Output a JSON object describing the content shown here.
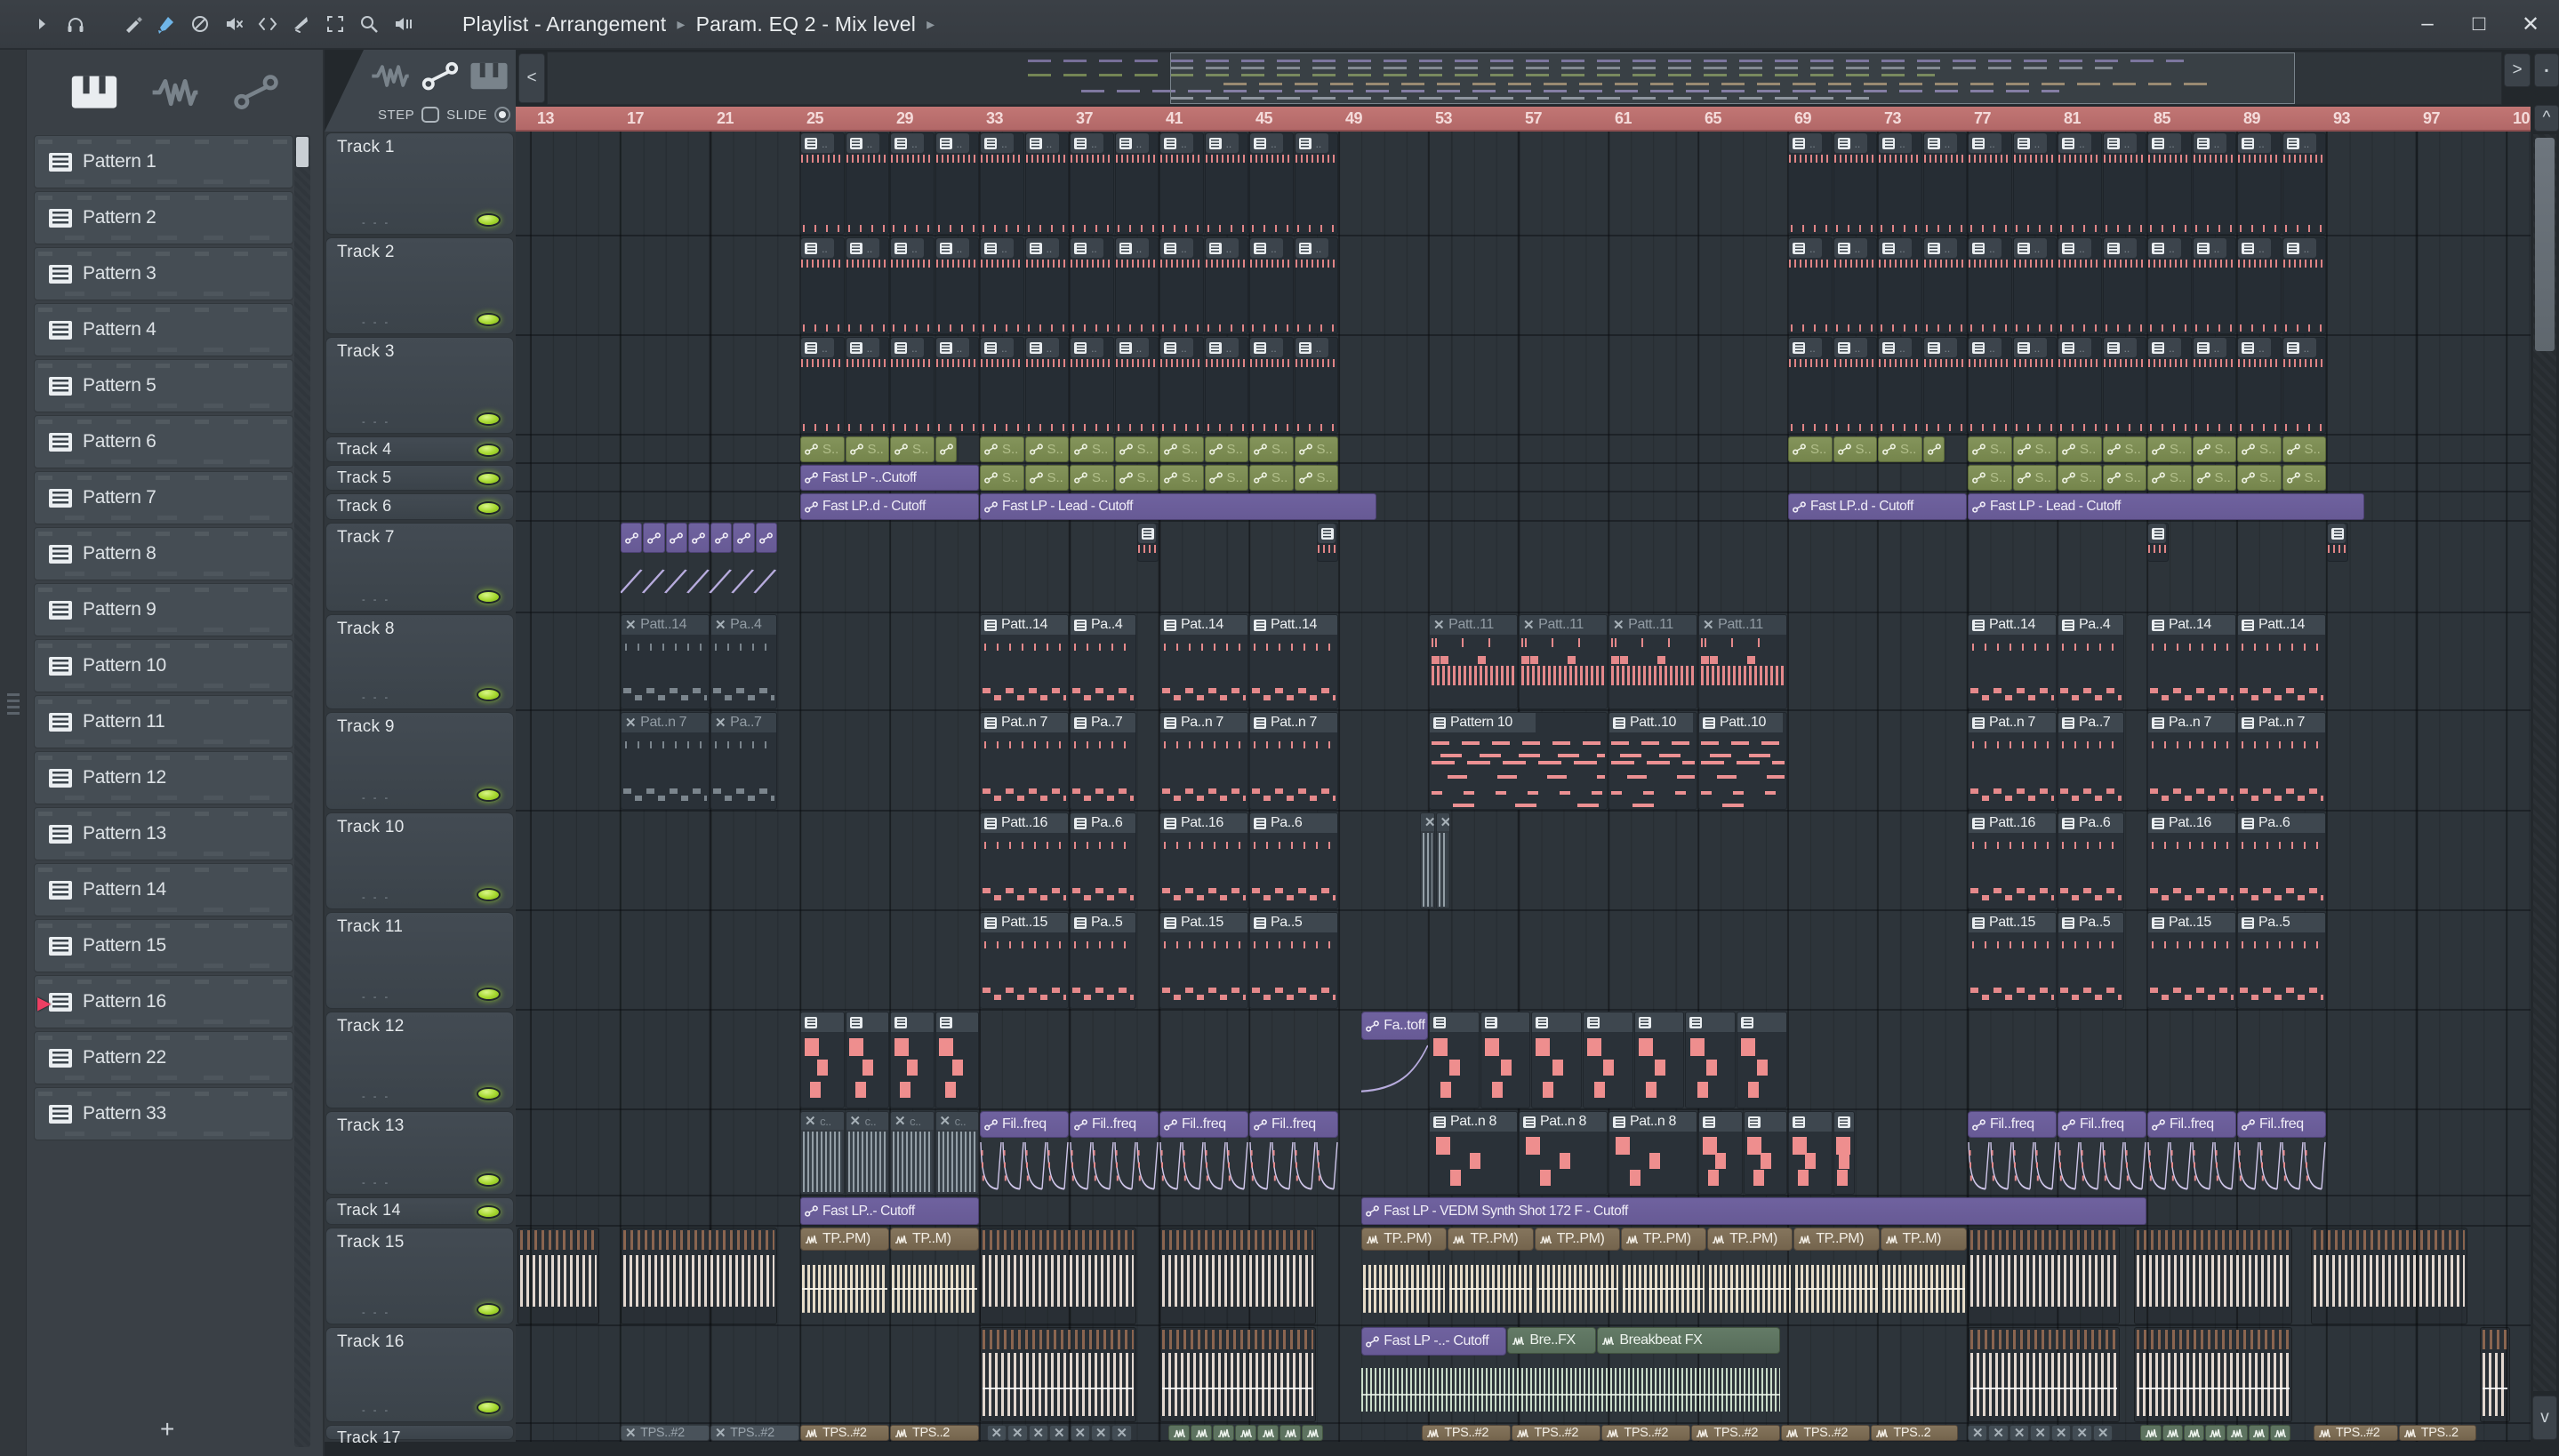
{
  "titlebar": {
    "crumb1": "Playlist - Arrangement",
    "crumb2": "Param. EQ 2 - Mix level",
    "window_buttons": [
      "–",
      "□",
      "✕"
    ],
    "tools": [
      "menu-arrow",
      "headphones",
      "draw",
      "paint",
      "delete",
      "mute",
      "slip",
      "slice",
      "select",
      "zoom",
      "playback"
    ],
    "active_tool": "paint"
  },
  "sidebar": {
    "tabs": [
      "piano",
      "wave",
      "slide"
    ],
    "active_tab": "piano",
    "patterns": [
      "Pattern 1",
      "Pattern 2",
      "Pattern 3",
      "Pattern 4",
      "Pattern 5",
      "Pattern 6",
      "Pattern 7",
      "Pattern 8",
      "Pattern 9",
      "Pattern 10",
      "Pattern 11",
      "Pattern 12",
      "Pattern 13",
      "Pattern 14",
      "Pattern 15",
      "Pattern 16",
      "Pattern 22",
      "Pattern 33"
    ],
    "playing_pattern": "Pattern 16",
    "add_label": "+"
  },
  "playlist": {
    "corner_tabs": [
      "wave",
      "slide",
      "piano"
    ],
    "step_label": "STEP",
    "slide_label": "SLIDE",
    "nav_buttons": {
      "left": "<",
      "right": ">",
      "up": "^",
      "down": "v",
      "detach": "▪"
    },
    "ruler_labels": [
      "13",
      "17",
      "21",
      "25",
      "29",
      "33",
      "37",
      "41",
      "45",
      "49",
      "53",
      "57",
      "61",
      "65",
      "69",
      "73",
      "77",
      "81",
      "85",
      "89",
      "93",
      "97",
      "10"
    ],
    "tracks": [
      "Track 1",
      "Track 2",
      "Track 3",
      "Track 4",
      "Track 5",
      "Track 6",
      "Track 7",
      "Track 8",
      "Track 9",
      "Track 10",
      "Track 11",
      "Track 12",
      "Track 13",
      "Track 14",
      "Track 15",
      "Track 16",
      "Track 17"
    ],
    "clips": [
      {
        "t": [
          1,
          2,
          3
        ],
        "s": 25,
        "w": 2,
        "n": 4,
        "type": "ticks"
      },
      {
        "t": [
          1,
          2,
          3
        ],
        "s": 33,
        "w": 2,
        "n": 8,
        "type": "ticks"
      },
      {
        "t": [
          1,
          2,
          3
        ],
        "s": 69,
        "w": 2,
        "n": 4,
        "type": "ticks"
      },
      {
        "t": [
          1,
          2,
          3
        ],
        "s": 77,
        "w": 2,
        "n": 8,
        "type": "ticks"
      },
      {
        "t": 4,
        "s": 25,
        "w": 2,
        "n": 3,
        "type": "ag",
        "label": "S.."
      },
      {
        "t": 4,
        "s": 31,
        "w": 1,
        "type": "ag",
        "label": ""
      },
      {
        "t": 4,
        "s": 33,
        "w": 2,
        "n": 8,
        "type": "ag",
        "label": "S.."
      },
      {
        "t": 4,
        "s": 69,
        "w": 2,
        "n": 3,
        "type": "ag",
        "label": "S.."
      },
      {
        "t": 4,
        "s": 75,
        "w": 1,
        "type": "ag",
        "label": ""
      },
      {
        "t": 4,
        "s": 77,
        "w": 2,
        "n": 8,
        "type": "ag",
        "label": "S.."
      },
      {
        "t": 5,
        "s": 25,
        "w": 8,
        "type": "ap",
        "label": "Fast LP -..Cutoff"
      },
      {
        "t": 5,
        "s": 33,
        "w": 2,
        "n": 8,
        "type": "ag",
        "label": "S.."
      },
      {
        "t": 5,
        "s": 77,
        "w": 2,
        "n": 8,
        "type": "ag",
        "label": "S.."
      },
      {
        "t": 6,
        "s": 25,
        "w": 8,
        "type": "ap",
        "label": "Fast LP..d - Cutoff"
      },
      {
        "t": 6,
        "s": 33,
        "w": 17.7,
        "type": "ap",
        "label": "Fast LP - Lead - Cutoff"
      },
      {
        "t": 6,
        "s": 69,
        "w": 8,
        "type": "ap",
        "label": "Fast LP..d - Cutoff"
      },
      {
        "t": 6,
        "s": 77,
        "w": 17.7,
        "type": "ap",
        "label": "Fast LP - Lead - Cutoff"
      },
      {
        "t": 7,
        "s": 17,
        "w": 1,
        "n": 7,
        "type": "ap7"
      },
      {
        "t": 7,
        "s": 17,
        "w": 7,
        "type": "curve7"
      },
      {
        "t": 7,
        "s": 40,
        "w": 1,
        "type": "ticks1"
      },
      {
        "t": 7,
        "s": 48,
        "w": 1,
        "type": "ticks1"
      },
      {
        "t": 7,
        "s": 85,
        "w": 1,
        "type": "ticks1"
      },
      {
        "t": 7,
        "s": 93,
        "w": 1,
        "type": "ticks1"
      },
      {
        "t": 8,
        "s": 17,
        "w": 4,
        "type": "drum",
        "muted": true,
        "label": "Patt..14"
      },
      {
        "t": 8,
        "s": 21,
        "w": 3,
        "type": "drum",
        "muted": true,
        "label": "Pa..4"
      },
      {
        "t": 8,
        "s": 33,
        "w": 4,
        "type": "drum",
        "label": "Patt..14"
      },
      {
        "t": 8,
        "s": 37,
        "w": 3,
        "type": "drum",
        "label": "Pa..4"
      },
      {
        "t": 8,
        "s": 41,
        "w": 4,
        "type": "drum",
        "label": "Pat..14"
      },
      {
        "t": 8,
        "s": 45,
        "w": 4,
        "type": "drum",
        "label": "Patt..14"
      },
      {
        "t": 8,
        "s": 53,
        "w": 4,
        "n": 4,
        "type": "fill",
        "muted": true,
        "label": "Patt..11"
      },
      {
        "t": 8,
        "s": 77,
        "w": 4,
        "type": "drum",
        "label": "Patt..14"
      },
      {
        "t": 8,
        "s": 81,
        "w": 3,
        "type": "drum",
        "label": "Pa..4"
      },
      {
        "t": 8,
        "s": 85,
        "w": 4,
        "type": "drum",
        "label": "Pat..14"
      },
      {
        "t": 8,
        "s": 89,
        "w": 4,
        "type": "drum",
        "label": "Patt..14"
      },
      {
        "t": 9,
        "s": 17,
        "w": 4,
        "type": "drum",
        "muted": true,
        "label": "Pat..n 7"
      },
      {
        "t": 9,
        "s": 21,
        "w": 3,
        "type": "drum",
        "muted": true,
        "label": "Pa..7"
      },
      {
        "t": 9,
        "s": 33,
        "w": 4,
        "type": "drum",
        "label": "Pat..n 7"
      },
      {
        "t": 9,
        "s": 37,
        "w": 3,
        "type": "drum",
        "label": "Pa..7"
      },
      {
        "t": 9,
        "s": 41,
        "w": 4,
        "type": "drum",
        "label": "Pa..n 7"
      },
      {
        "t": 9,
        "s": 45,
        "w": 4,
        "type": "drum",
        "label": "Pat..n 7"
      },
      {
        "t": 9,
        "s": 53,
        "w": 8,
        "type": "melody",
        "label": "Pattern 10"
      },
      {
        "t": 9,
        "s": 61,
        "w": 4,
        "type": "melody",
        "label": "Patt..10"
      },
      {
        "t": 9,
        "s": 65,
        "w": 4,
        "type": "melody",
        "label": "Patt..10"
      },
      {
        "t": 9,
        "s": 77,
        "w": 4,
        "type": "drum",
        "label": "Pat..n 7"
      },
      {
        "t": 9,
        "s": 81,
        "w": 3,
        "type": "drum",
        "label": "Pa..7"
      },
      {
        "t": 9,
        "s": 85,
        "w": 4,
        "type": "drum",
        "label": "Pa..n 7"
      },
      {
        "t": 9,
        "s": 89,
        "w": 4,
        "type": "drum",
        "label": "Pat..n 7"
      },
      {
        "t": 10,
        "s": 33,
        "w": 4,
        "type": "drum",
        "label": "Patt..16"
      },
      {
        "t": 10,
        "s": 37,
        "w": 3,
        "type": "drum",
        "label": "Pa..6"
      },
      {
        "t": 10,
        "s": 41,
        "w": 4,
        "type": "drum",
        "label": "Pat..16"
      },
      {
        "t": 10,
        "s": 45,
        "w": 4,
        "type": "drum",
        "label": "Pa..6"
      },
      {
        "t": 10,
        "s": 52.6,
        "w": 0.7,
        "n": 2,
        "type": "xwave",
        "label": ""
      },
      {
        "t": 10,
        "s": 77,
        "w": 4,
        "type": "drum",
        "label": "Patt..16"
      },
      {
        "t": 10,
        "s": 81,
        "w": 3,
        "type": "drum",
        "label": "Pa..6"
      },
      {
        "t": 10,
        "s": 85,
        "w": 4,
        "type": "drum",
        "label": "Pat..16"
      },
      {
        "t": 10,
        "s": 89,
        "w": 4,
        "type": "drum",
        "label": "Pa..6"
      },
      {
        "t": 11,
        "s": 33,
        "w": 4,
        "type": "drum",
        "label": "Patt..15"
      },
      {
        "t": 11,
        "s": 37,
        "w": 3,
        "type": "drum",
        "label": "Pa..5"
      },
      {
        "t": 11,
        "s": 41,
        "w": 4,
        "type": "drum",
        "label": "Pat..15"
      },
      {
        "t": 11,
        "s": 45,
        "w": 4,
        "type": "drum",
        "label": "Pa..5"
      },
      {
        "t": 11,
        "s": 77,
        "w": 4,
        "type": "drum",
        "label": "Patt..15"
      },
      {
        "t": 11,
        "s": 81,
        "w": 3,
        "type": "drum",
        "label": "Pa..5"
      },
      {
        "t": 11,
        "s": 85,
        "w": 4,
        "type": "drum",
        "label": "Pat..15"
      },
      {
        "t": 11,
        "s": 89,
        "w": 4,
        "type": "drum",
        "label": "Pa..5"
      },
      {
        "t": 12,
        "s": 25,
        "w": 2,
        "n": 4,
        "type": "kick",
        "label": ""
      },
      {
        "t": 12,
        "s": 50,
        "w": 3,
        "type": "apc",
        "label": "Fa..toff"
      },
      {
        "t": 12,
        "s": 53,
        "w": 2.285,
        "n": 7,
        "type": "kick",
        "label": ""
      },
      {
        "t": 13,
        "s": 25,
        "w": 2,
        "n": 4,
        "type": "xwave",
        "label": "c.."
      },
      {
        "t": 13,
        "s": 33,
        "w": 4,
        "n": 4,
        "type": "filfreq",
        "label": "Fil..freq"
      },
      {
        "t": 13,
        "s": 53,
        "w": 4,
        "n": 3,
        "type": "kick",
        "label": "Pat..n 8"
      },
      {
        "t": 13,
        "s": 65,
        "w": 2,
        "n": 3,
        "type": "kick",
        "label": ""
      },
      {
        "t": 13,
        "s": 71,
        "w": 1,
        "type": "kick",
        "label": ""
      },
      {
        "t": 13,
        "s": 77,
        "w": 4,
        "n": 4,
        "type": "filfreq",
        "label": "Fil..freq"
      },
      {
        "t": 14,
        "s": 25,
        "w": 8,
        "type": "ap",
        "label": "Fast LP..- Cutoff"
      },
      {
        "t": 14,
        "s": 50,
        "w": 35,
        "type": "ap",
        "label": "Fast LP - VEDM Synth Shot 172 F - Cutoff"
      },
      {
        "t": 15,
        "s": 12.4,
        "w": 3.7,
        "type": "stripes"
      },
      {
        "t": 15,
        "s": 17,
        "w": 7,
        "type": "stripes"
      },
      {
        "t": 15,
        "s": 25,
        "w": 4,
        "type": "tp",
        "label": "TP..PM)"
      },
      {
        "t": 15,
        "s": 29,
        "w": 4,
        "type": "tp",
        "label": "TP..M)"
      },
      {
        "t": 15,
        "s": 33,
        "w": 7,
        "type": "stripes"
      },
      {
        "t": 15,
        "s": 41,
        "w": 7,
        "type": "stripes"
      },
      {
        "t": 15,
        "s": 50,
        "w": 3.85,
        "n": 6,
        "type": "tp",
        "label": "TP..PM)"
      },
      {
        "t": 15,
        "s": 73.1,
        "w": 3.9,
        "type": "tp",
        "label": "TP..M)"
      },
      {
        "t": 15,
        "s": 77,
        "w": 6.8,
        "type": "stripes"
      },
      {
        "t": 15,
        "s": 84.4,
        "w": 7.1,
        "type": "stripes"
      },
      {
        "t": 15,
        "s": 92.3,
        "w": 7,
        "type": "stripes"
      },
      {
        "t": 16,
        "s": 33,
        "w": 7,
        "type": "stripes2"
      },
      {
        "t": 16,
        "s": 41,
        "w": 7,
        "type": "stripes2"
      },
      {
        "t": 16,
        "s": 50,
        "w": 18.7,
        "type": "gwave"
      },
      {
        "t": 16,
        "s": 50,
        "w": 6.5,
        "type": "aph",
        "label": "Fast LP -..- Cutoff"
      },
      {
        "t": 16,
        "s": 56.5,
        "w": 4,
        "type": "bfx",
        "label": "Bre..FX"
      },
      {
        "t": 16,
        "s": 60.5,
        "w": 8.2,
        "type": "bfx",
        "label": "Breakbeat FX"
      },
      {
        "t": 16,
        "s": 77,
        "w": 6.8,
        "type": "stripes2"
      },
      {
        "t": 16,
        "s": 84.4,
        "w": 7.1,
        "type": "stripes2"
      },
      {
        "t": 16,
        "s": 99.8,
        "w": 1.4,
        "type": "stripes2"
      },
      {
        "t": 17,
        "s": 17,
        "w": 4,
        "type": "tp17",
        "muted": true,
        "label": "TPS..#2"
      },
      {
        "t": 17,
        "s": 21,
        "w": 4,
        "type": "tp17",
        "muted": true,
        "label": "TPS..#2"
      },
      {
        "t": 17,
        "s": 25,
        "w": 4,
        "type": "tp17",
        "label": "TPS..#2"
      },
      {
        "t": 17,
        "s": 29,
        "w": 4,
        "type": "tp17",
        "label": "TPS..2"
      },
      {
        "t": 17,
        "s": 33.3,
        "w": 0.93,
        "n": 7,
        "type": "tinyx"
      },
      {
        "t": 17,
        "s": 41.4,
        "w": 0.99,
        "n": 7,
        "type": "tinyg"
      },
      {
        "t": 17,
        "s": 52.7,
        "w": 4,
        "n": 5,
        "type": "tp17",
        "label": "TPS..#2"
      },
      {
        "t": 17,
        "s": 72.7,
        "w": 3.9,
        "type": "tp17",
        "label": "TPS..2"
      },
      {
        "t": 17,
        "s": 77,
        "w": 0.93,
        "n": 7,
        "type": "tinyx"
      },
      {
        "t": 17,
        "s": 84.7,
        "w": 0.96,
        "n": 7,
        "type": "tinyg"
      },
      {
        "t": 17,
        "s": 92.4,
        "w": 3.8,
        "type": "tp17",
        "label": "TPS..#2"
      },
      {
        "t": 17,
        "s": 96.2,
        "w": 3.5,
        "type": "tp17",
        "label": "TPS..2"
      }
    ]
  },
  "colors": {
    "accent_notes": "#e5898b",
    "clip_green": "#7d8d4f",
    "clip_purple": "#6b5e9a",
    "clip_tan": "#7c6b53",
    "clip_breakfx": "#5d7360",
    "ruler": "#b96b6b",
    "led_green": "#a6d82f",
    "tool_active_blue": "#6fb5e8"
  }
}
